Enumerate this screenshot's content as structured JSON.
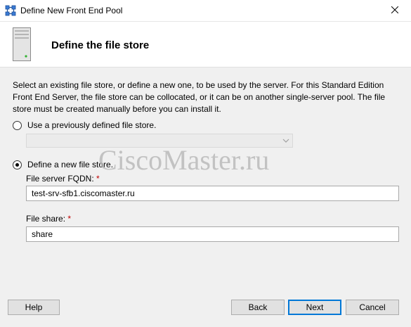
{
  "window": {
    "title": "Define New Front End Pool",
    "app_icon": "pool-icon",
    "close_icon": "close-icon"
  },
  "header": {
    "title": "Define the file store",
    "icon": "server-icon"
  },
  "main": {
    "description": "Select an existing file store, or define a new one, to be used by the server. For this Standard Edition Front End Server, the file store can be collocated, or it can be on another single-server pool. The file store must be created manually before you can install it.",
    "option_existing": {
      "label": "Use a previously defined file store.",
      "selected": false
    },
    "existing_dropdown": {
      "value": ""
    },
    "option_new": {
      "label": "Define a new file store.",
      "selected": true
    },
    "fqdn_label": "File server FQDN:",
    "fqdn_value": "test-srv-sfb1.ciscomaster.ru",
    "share_label": "File share:",
    "share_value": "share",
    "required_mark": "*"
  },
  "watermark": "CiscoMaster.ru",
  "buttons": {
    "help": "Help",
    "back": "Back",
    "next": "Next",
    "cancel": "Cancel"
  },
  "colors": {
    "content_bg": "#f0f0f0",
    "required": "#c00000",
    "default_button_border": "#0078d7"
  }
}
